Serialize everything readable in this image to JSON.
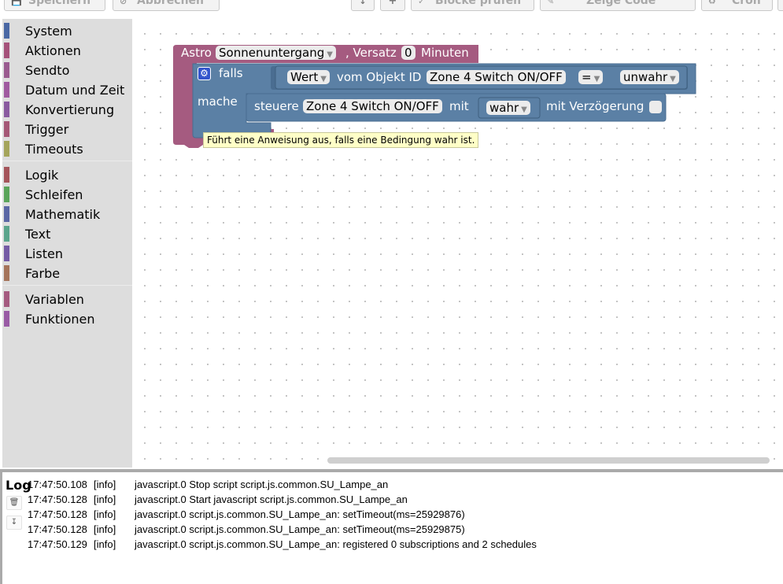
{
  "toolbar": {
    "buttons": [
      {
        "icon": "save-icon",
        "label": "Speichern"
      },
      {
        "icon": "cancel-icon",
        "label": "Abbrechen"
      },
      {
        "icon": "export-icon",
        "label": ""
      },
      {
        "icon": "plus-icon",
        "label": ""
      },
      {
        "icon": "check-icon",
        "label": "Blöcke prüfen"
      },
      {
        "icon": "code-icon",
        "label": "Zeige Code"
      },
      {
        "icon": "cron-icon",
        "label": "Cron"
      }
    ]
  },
  "toolbox": {
    "categories": [
      {
        "label": "System",
        "color": "#4a68a4"
      },
      {
        "label": "Aktionen",
        "color": "#a5527a"
      },
      {
        "label": "Sendto",
        "color": "#9a5b8f"
      },
      {
        "label": "Datum und Zeit",
        "color": "#a05aa0"
      },
      {
        "label": "Konvertierung",
        "color": "#8a5ba0"
      },
      {
        "label": "Trigger",
        "color": "#a55876"
      },
      {
        "label": "Timeouts",
        "color": "#a5a55b"
      },
      {
        "label": "Logik",
        "color": "#a5555b"
      },
      {
        "label": "Schleifen",
        "color": "#5ba55b"
      },
      {
        "label": "Mathematik",
        "color": "#5b67a5"
      },
      {
        "label": "Text",
        "color": "#5ba58c"
      },
      {
        "label": "Listen",
        "color": "#745ba5"
      },
      {
        "label": "Farbe",
        "color": "#a5745b"
      },
      {
        "label": "Variablen",
        "color": "#a55b80"
      },
      {
        "label": "Funktionen",
        "color": "#995ba5"
      }
    ]
  },
  "blocks": {
    "astro": {
      "prefix": "Astro",
      "event": "Sonnenuntergang",
      "offset_label": ", Versatz",
      "offset": "0",
      "unit": "Minuten",
      "color": "#a55b80"
    },
    "if": {
      "falls": "falls",
      "mache": "mache",
      "color": "#5b80a5"
    },
    "condition": {
      "value_dd": "Wert",
      "object_label": "vom Objekt ID",
      "object": "Zone 4 Switch ON/OFF",
      "operator": "=",
      "compare": "unwahr"
    },
    "control": {
      "label": "steuere",
      "object": "Zone 4 Switch ON/OFF",
      "with": "mit",
      "value": "wahr",
      "delay_label": "mit Verzögerung"
    }
  },
  "tooltip": "Führt eine Anweisung aus, falls eine Bedingung wahr ist.",
  "log": {
    "title": "Log",
    "rows": [
      {
        "time": "17:47:50.108",
        "severity": "[info]",
        "message": "javascript.0 Stop script script.js.common.SU_Lampe_an"
      },
      {
        "time": "17:47:50.128",
        "severity": "[info]",
        "message": "javascript.0 Start javascript script.js.common.SU_Lampe_an"
      },
      {
        "time": "17:47:50.128",
        "severity": "[info]",
        "message": "javascript.0 script.js.common.SU_Lampe_an: setTimeout(ms=25929876)"
      },
      {
        "time": "17:47:50.128",
        "severity": "[info]",
        "message": "javascript.0 script.js.common.SU_Lampe_an: setTimeout(ms=25929875)"
      },
      {
        "time": "17:47:50.129",
        "severity": "[info]",
        "message": "javascript.0 script.js.common.SU_Lampe_an: registered 0 subscriptions and 2 schedules"
      }
    ]
  }
}
